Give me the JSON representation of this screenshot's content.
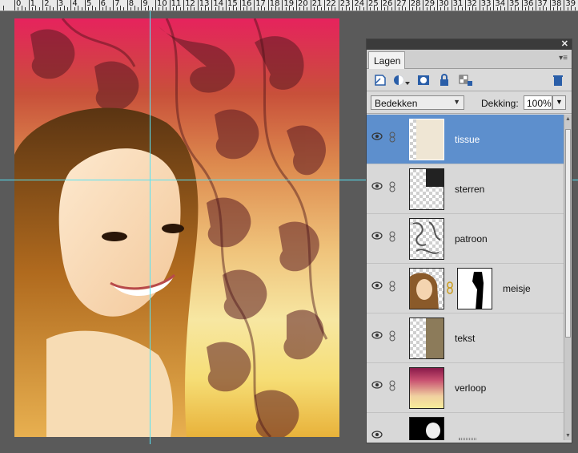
{
  "ruler": {
    "labels": [
      "0",
      "1",
      "2",
      "3",
      "4",
      "5",
      "6",
      "7",
      "8",
      "9",
      "10",
      "11",
      "12",
      "13",
      "14",
      "15",
      "16",
      "17",
      "18",
      "19",
      "20",
      "21",
      "22",
      "23",
      "24",
      "25",
      "26",
      "27",
      "28",
      "29",
      "30",
      "31",
      "32",
      "33",
      "34",
      "35",
      "36",
      "37",
      "38",
      "39",
      "40"
    ]
  },
  "panel": {
    "tab_label": "Lagen",
    "blend_mode": "Bedekken",
    "opacity_label": "Dekking:",
    "opacity_value": "100%",
    "layers": [
      {
        "name": "tissue",
        "selected": true
      },
      {
        "name": "sterren",
        "selected": false
      },
      {
        "name": "patroon",
        "selected": false
      },
      {
        "name": "meisje",
        "selected": false,
        "has_mask": true
      },
      {
        "name": "tekst",
        "selected": false
      },
      {
        "name": "verloop",
        "selected": false
      },
      {
        "name": "",
        "selected": false
      }
    ]
  },
  "colors": {
    "guide": "#56e3f4",
    "selected_layer": "#5d8fcd",
    "workspace": "#5a5a5a"
  }
}
